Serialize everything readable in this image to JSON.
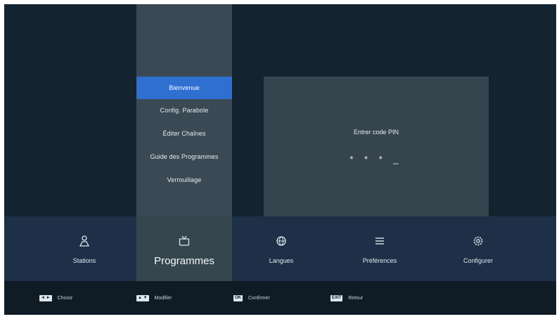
{
  "menu": {
    "items": [
      {
        "label": "Bienvenue",
        "selected": true
      },
      {
        "label": "Config. Parabole",
        "selected": false
      },
      {
        "label": "Éditer Chaînes",
        "selected": false
      },
      {
        "label": "Guide des Programmes",
        "selected": false
      },
      {
        "label": "Verrouillage",
        "selected": false
      }
    ]
  },
  "pin": {
    "label": "Entrer code PIN",
    "dots": "* * * _"
  },
  "tabs": [
    {
      "label": "Stations",
      "icon": "person-icon",
      "active": false
    },
    {
      "label": "Programmes",
      "icon": "tv-icon",
      "active": true
    },
    {
      "label": "Langues",
      "icon": "globe-icon",
      "active": false
    },
    {
      "label": "Préférences",
      "icon": "list-icon",
      "active": false
    },
    {
      "label": "Configurer",
      "icon": "gear-icon",
      "active": false
    }
  ],
  "footer": {
    "hints": [
      {
        "key": "◄ ►",
        "label": "Choisir"
      },
      {
        "key": "▲ ▼",
        "label": "Modifier"
      },
      {
        "key": "OK",
        "label": "Confirmer"
      },
      {
        "key": "EXIT",
        "label": "Retour"
      }
    ]
  },
  "colors": {
    "background": "#13232f",
    "selected": "#2f6fd0",
    "tabbar": "#1e3048",
    "footer": "#0f1c26"
  }
}
